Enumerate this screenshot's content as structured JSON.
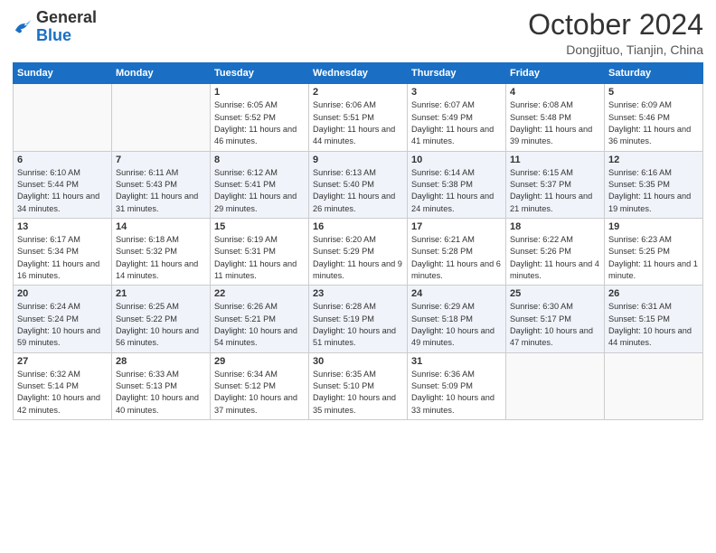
{
  "header": {
    "logo_general": "General",
    "logo_blue": "Blue",
    "month_title": "October 2024",
    "location": "Dongjituo, Tianjin, China"
  },
  "days_of_week": [
    "Sunday",
    "Monday",
    "Tuesday",
    "Wednesday",
    "Thursday",
    "Friday",
    "Saturday"
  ],
  "weeks": [
    [
      {
        "day": "",
        "info": ""
      },
      {
        "day": "",
        "info": ""
      },
      {
        "day": "1",
        "info": "Sunrise: 6:05 AM\nSunset: 5:52 PM\nDaylight: 11 hours and 46 minutes."
      },
      {
        "day": "2",
        "info": "Sunrise: 6:06 AM\nSunset: 5:51 PM\nDaylight: 11 hours and 44 minutes."
      },
      {
        "day": "3",
        "info": "Sunrise: 6:07 AM\nSunset: 5:49 PM\nDaylight: 11 hours and 41 minutes."
      },
      {
        "day": "4",
        "info": "Sunrise: 6:08 AM\nSunset: 5:48 PM\nDaylight: 11 hours and 39 minutes."
      },
      {
        "day": "5",
        "info": "Sunrise: 6:09 AM\nSunset: 5:46 PM\nDaylight: 11 hours and 36 minutes."
      }
    ],
    [
      {
        "day": "6",
        "info": "Sunrise: 6:10 AM\nSunset: 5:44 PM\nDaylight: 11 hours and 34 minutes."
      },
      {
        "day": "7",
        "info": "Sunrise: 6:11 AM\nSunset: 5:43 PM\nDaylight: 11 hours and 31 minutes."
      },
      {
        "day": "8",
        "info": "Sunrise: 6:12 AM\nSunset: 5:41 PM\nDaylight: 11 hours and 29 minutes."
      },
      {
        "day": "9",
        "info": "Sunrise: 6:13 AM\nSunset: 5:40 PM\nDaylight: 11 hours and 26 minutes."
      },
      {
        "day": "10",
        "info": "Sunrise: 6:14 AM\nSunset: 5:38 PM\nDaylight: 11 hours and 24 minutes."
      },
      {
        "day": "11",
        "info": "Sunrise: 6:15 AM\nSunset: 5:37 PM\nDaylight: 11 hours and 21 minutes."
      },
      {
        "day": "12",
        "info": "Sunrise: 6:16 AM\nSunset: 5:35 PM\nDaylight: 11 hours and 19 minutes."
      }
    ],
    [
      {
        "day": "13",
        "info": "Sunrise: 6:17 AM\nSunset: 5:34 PM\nDaylight: 11 hours and 16 minutes."
      },
      {
        "day": "14",
        "info": "Sunrise: 6:18 AM\nSunset: 5:32 PM\nDaylight: 11 hours and 14 minutes."
      },
      {
        "day": "15",
        "info": "Sunrise: 6:19 AM\nSunset: 5:31 PM\nDaylight: 11 hours and 11 minutes."
      },
      {
        "day": "16",
        "info": "Sunrise: 6:20 AM\nSunset: 5:29 PM\nDaylight: 11 hours and 9 minutes."
      },
      {
        "day": "17",
        "info": "Sunrise: 6:21 AM\nSunset: 5:28 PM\nDaylight: 11 hours and 6 minutes."
      },
      {
        "day": "18",
        "info": "Sunrise: 6:22 AM\nSunset: 5:26 PM\nDaylight: 11 hours and 4 minutes."
      },
      {
        "day": "19",
        "info": "Sunrise: 6:23 AM\nSunset: 5:25 PM\nDaylight: 11 hours and 1 minute."
      }
    ],
    [
      {
        "day": "20",
        "info": "Sunrise: 6:24 AM\nSunset: 5:24 PM\nDaylight: 10 hours and 59 minutes."
      },
      {
        "day": "21",
        "info": "Sunrise: 6:25 AM\nSunset: 5:22 PM\nDaylight: 10 hours and 56 minutes."
      },
      {
        "day": "22",
        "info": "Sunrise: 6:26 AM\nSunset: 5:21 PM\nDaylight: 10 hours and 54 minutes."
      },
      {
        "day": "23",
        "info": "Sunrise: 6:28 AM\nSunset: 5:19 PM\nDaylight: 10 hours and 51 minutes."
      },
      {
        "day": "24",
        "info": "Sunrise: 6:29 AM\nSunset: 5:18 PM\nDaylight: 10 hours and 49 minutes."
      },
      {
        "day": "25",
        "info": "Sunrise: 6:30 AM\nSunset: 5:17 PM\nDaylight: 10 hours and 47 minutes."
      },
      {
        "day": "26",
        "info": "Sunrise: 6:31 AM\nSunset: 5:15 PM\nDaylight: 10 hours and 44 minutes."
      }
    ],
    [
      {
        "day": "27",
        "info": "Sunrise: 6:32 AM\nSunset: 5:14 PM\nDaylight: 10 hours and 42 minutes."
      },
      {
        "day": "28",
        "info": "Sunrise: 6:33 AM\nSunset: 5:13 PM\nDaylight: 10 hours and 40 minutes."
      },
      {
        "day": "29",
        "info": "Sunrise: 6:34 AM\nSunset: 5:12 PM\nDaylight: 10 hours and 37 minutes."
      },
      {
        "day": "30",
        "info": "Sunrise: 6:35 AM\nSunset: 5:10 PM\nDaylight: 10 hours and 35 minutes."
      },
      {
        "day": "31",
        "info": "Sunrise: 6:36 AM\nSunset: 5:09 PM\nDaylight: 10 hours and 33 minutes."
      },
      {
        "day": "",
        "info": ""
      },
      {
        "day": "",
        "info": ""
      }
    ]
  ]
}
